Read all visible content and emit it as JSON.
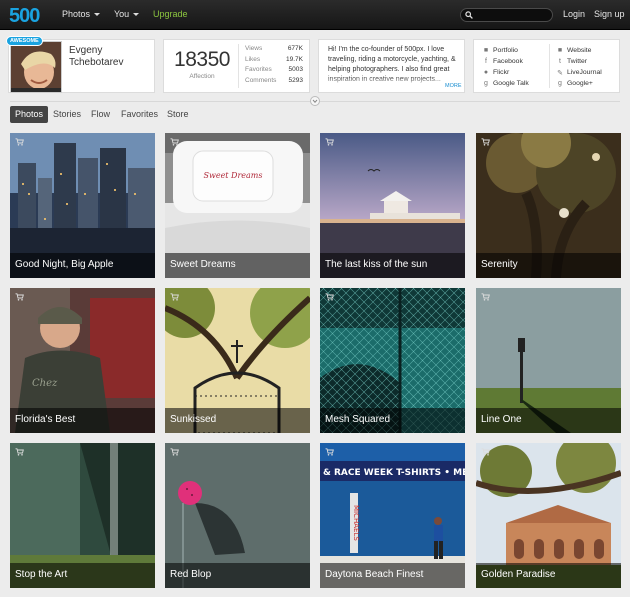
{
  "nav": {
    "logo": "500",
    "photos": "Photos",
    "you": "You",
    "upgrade": "Upgrade",
    "search_placeholder": "",
    "login": "Login",
    "signup": "Sign up"
  },
  "profile": {
    "badge": "AWESOME",
    "name": "Evgeny Tchebotarev",
    "affection_value": "18350",
    "affection_label": "Affection",
    "stats": [
      {
        "label": "Views",
        "value": "677K"
      },
      {
        "label": "Likes",
        "value": "19.7K"
      },
      {
        "label": "Favorites",
        "value": "5003"
      },
      {
        "label": "Comments",
        "value": "5293"
      }
    ],
    "bio": "Hi! I'm the co-founder of 500px. I love traveling, riding a motorcycle, yachting, & helping photographers. I also find great inspiration in creative new projects...",
    "more": "MORE",
    "links_col1": [
      {
        "icon": "portfolio-icon",
        "glyph": "■",
        "label": "Portfolio"
      },
      {
        "icon": "facebook-icon",
        "glyph": "f",
        "label": "Facebook"
      },
      {
        "icon": "flickr-icon",
        "glyph": "●",
        "label": "Flickr"
      },
      {
        "icon": "gtalk-icon",
        "glyph": "g",
        "label": "Google Talk"
      }
    ],
    "links_col2": [
      {
        "icon": "website-icon",
        "glyph": "■",
        "label": "Website"
      },
      {
        "icon": "twitter-icon",
        "glyph": "t",
        "label": "Twitter"
      },
      {
        "icon": "livejournal-icon",
        "glyph": "✎",
        "label": "LiveJournal"
      },
      {
        "icon": "googleplus-icon",
        "glyph": "g",
        "label": "Google+"
      }
    ]
  },
  "tabs": [
    "Photos",
    "Stories",
    "Flow",
    "Favorites",
    "Store"
  ],
  "photos": [
    {
      "title": "Good Night, Big Apple",
      "scene": "city"
    },
    {
      "title": "Sweet Dreams",
      "scene": "pillow",
      "pillow_text": "Sweet Dreams"
    },
    {
      "title": "The last kiss of the sun",
      "scene": "beach"
    },
    {
      "title": "Serenity",
      "scene": "tree"
    },
    {
      "title": "Florida's Best",
      "scene": "man"
    },
    {
      "title": "Sunkissed",
      "scene": "gate"
    },
    {
      "title": "Mesh Squared",
      "scene": "mesh"
    },
    {
      "title": "Line One",
      "scene": "pole"
    },
    {
      "title": "Stop the Art",
      "scene": "wall"
    },
    {
      "title": "Red Blop",
      "scene": "ball"
    },
    {
      "title": "Daytona Beach Finest",
      "scene": "street",
      "sign_text": "& RACE WEEK T-SHIRTS • MEN'S",
      "vertical_text": "MICHAELS"
    },
    {
      "title": "Golden Paradise",
      "scene": "paradise"
    }
  ],
  "colors": {
    "accent": "#1aa3e0",
    "upgrade": "#8cc63f",
    "topbar": "#1c1c1c"
  }
}
